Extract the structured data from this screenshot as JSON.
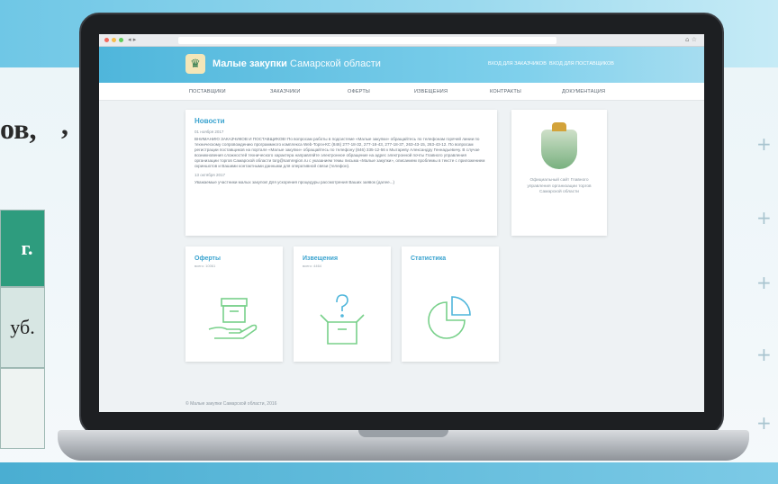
{
  "slide": {
    "title_fragment": "ов,",
    "comma": ",",
    "cell_year": "г.",
    "cell_price": "уб."
  },
  "browser": {
    "nav": "◂ ▸",
    "icons": "⌂ ☆"
  },
  "site": {
    "logo_glyph": "♛",
    "title_bold": "Малые закупки",
    "title_region": "Самарской области",
    "login_customer": "Вход для заказчиков",
    "login_supplier": "Вход для поставщиков"
  },
  "menu": [
    "ПОСТАВЩИКИ",
    "ЗАКАЗЧИКИ",
    "ОФЕРТЫ",
    "ИЗВЕЩЕНИЯ",
    "КОНТРАКТЫ",
    "ДОКУМЕНТАЦИЯ"
  ],
  "news": {
    "title": "Новости",
    "items": [
      {
        "date": "01 ноября 2017",
        "text": "ВНИМАНИЮ ЗАКАЗЧИКОВ И ПОСТАВЩИКОВ! По вопросам работы в подсистеме «Малые закупки» обращайтесь по телефонам горячей линии по техническому сопровождению программного комплекса Web-Торги-КС (846) 277-18-32, 277-18-43, 277-18-37, 263-43-15, 263-43-12. По вопросам регистрации поставщиков на портале «Малые закупки» обращайтесь по телефону (846) 335-12-56 к Мытареву Александру Геннадьевичу. В случае возникновения сложностей технического характера направляйте электронное обращение на адрес электронной почты Главного управления организации торгов Самарской области torg@samregion.ru с указанием темы письма «Малые закупки», описанием проблемы в тексте с приложением скриншотов и Вашими контактными данными для оперативной связи (телефон)."
      },
      {
        "date": "13 октября 2017",
        "text": "Уважаемые участники малых закупок! Для ускорения процедуры рассмотрения Ваших заявок (далее...)"
      }
    ]
  },
  "emblem_card": {
    "text": "Официальный сайт Главного управления организации торгов Самарской области"
  },
  "tiles": [
    {
      "title": "Оферты",
      "sub": "всего: 10061",
      "icon": "box-in-hand-icon"
    },
    {
      "title": "Извещения",
      "sub": "всего: 4464",
      "icon": "question-box-icon"
    },
    {
      "title": "Статистика",
      "sub": "",
      "icon": "pie-chart-icon"
    }
  ],
  "footer": "© Малые закупки Самарской области, 2016",
  "colors": {
    "accent": "#3aa3cf",
    "header": "#4fb6db",
    "slide_green": "#2e9c7e"
  }
}
